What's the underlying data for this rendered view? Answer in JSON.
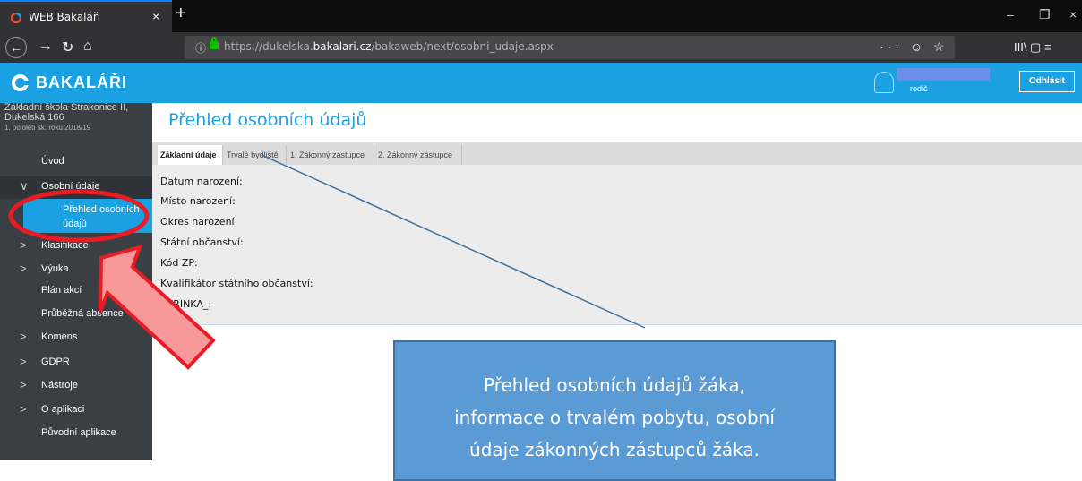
{
  "browser": {
    "tab_title": "WEB Bakaláři",
    "tab_close": "×",
    "new_tab": "+",
    "minimize": "–",
    "restore": "❐",
    "close": "×",
    "url_prefix": "https://dukelska.",
    "url_domain": "bakalari.cz",
    "url_path": "/bakaweb/next/osobni_udaje.aspx",
    "url_actions": "··· ☺ ☆",
    "toolbar_right": "III\\ ▢ ≡"
  },
  "header": {
    "logo_text": "BAKALÁŘI",
    "user_role": "rodič",
    "logout_label": "Odhlásit",
    "accent": "#1ba1e2"
  },
  "school": {
    "line1": "Základní škola Strakonice II,",
    "line2": "Dukelská 166",
    "line3": "1. pololetí šk. roku 2018/19"
  },
  "sidebar": {
    "items": [
      {
        "label": "Úvod",
        "chev": ""
      },
      {
        "label": "Osobní údaje",
        "chev": "∨"
      },
      {
        "label": "Přehled osobních údajů",
        "chev": ""
      },
      {
        "label": "Klasifikace",
        "chev": ">"
      },
      {
        "label": "Výuka",
        "chev": ">"
      },
      {
        "label": "Plán akcí",
        "chev": ""
      },
      {
        "label": "Průběžná absence",
        "chev": ""
      },
      {
        "label": "Komens",
        "chev": ">"
      },
      {
        "label": "GDPR",
        "chev": ">"
      },
      {
        "label": "Nástroje",
        "chev": ">"
      },
      {
        "label": "O aplikaci",
        "chev": ">"
      },
      {
        "label": "Původní aplikace",
        "chev": ""
      }
    ]
  },
  "main": {
    "title": "Přehled osobních údajů",
    "tabs": [
      "Základní údaje",
      "Trvalé bydliště",
      "1. Zákonný zástupce",
      "2. Zákonný zástupce"
    ],
    "fields": [
      "Datum narození:",
      "Místo narození:",
      "Okres narození:",
      "Státní občanství:",
      "Kód ZP:",
      "Kvalifikátor státního občanství:",
      "SKRINKA_:"
    ]
  },
  "annotation": {
    "lines": [
      "Přehled osobních údajů žáka,",
      "informace o trvalém pobytu, osobní",
      "údaje zákonných zástupců žáka."
    ]
  }
}
